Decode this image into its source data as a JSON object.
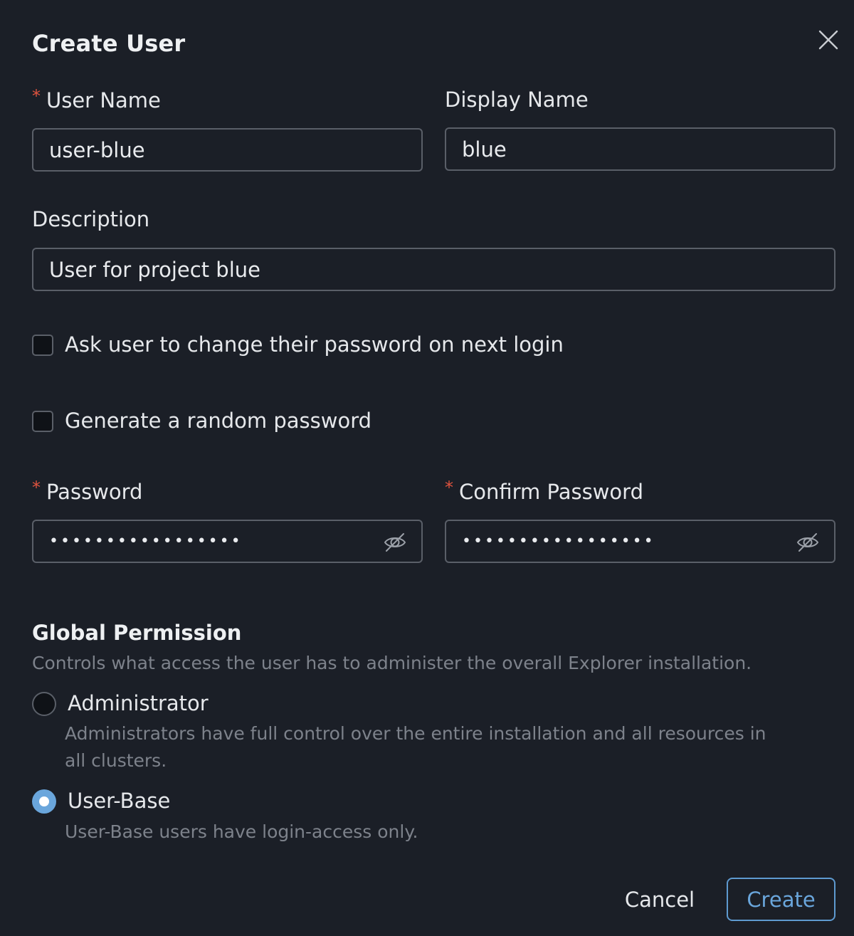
{
  "dialog": {
    "title": "Create User",
    "close_icon": "close-icon"
  },
  "form": {
    "username": {
      "label": "User Name",
      "required_mark": "*",
      "value": "user-blue"
    },
    "display_name": {
      "label": "Display Name",
      "value": "blue"
    },
    "description": {
      "label": "Description",
      "value": "User for project blue"
    },
    "change_password_checkbox": {
      "label": "Ask user to change their password on next login",
      "checked": false
    },
    "random_password_checkbox": {
      "label": "Generate a random password",
      "checked": false
    },
    "password": {
      "label": "Password",
      "required_mark": "*",
      "masked_value": "•••••••••••••••••",
      "toggle_icon": "eye-slash-icon"
    },
    "confirm_password": {
      "label": "Confirm Password",
      "required_mark": "*",
      "masked_value": "•••••••••••••••••",
      "toggle_icon": "eye-slash-icon"
    }
  },
  "global_permission": {
    "title": "Global Permission",
    "description": "Controls what access the user has to administer the overall Explorer installation.",
    "options": [
      {
        "label": "Administrator",
        "description": "Administrators have full control over the entire installation and all resources in all clusters.",
        "selected": false
      },
      {
        "label": "User-Base",
        "description": "User-Base users have login-access only.",
        "selected": true
      }
    ]
  },
  "footer": {
    "cancel_label": "Cancel",
    "create_label": "Create"
  },
  "colors": {
    "background": "#1b1f27",
    "accent": "#6aa6dc",
    "required": "#e0533f",
    "muted_text": "#7d828b",
    "border": "#5a5f68"
  }
}
